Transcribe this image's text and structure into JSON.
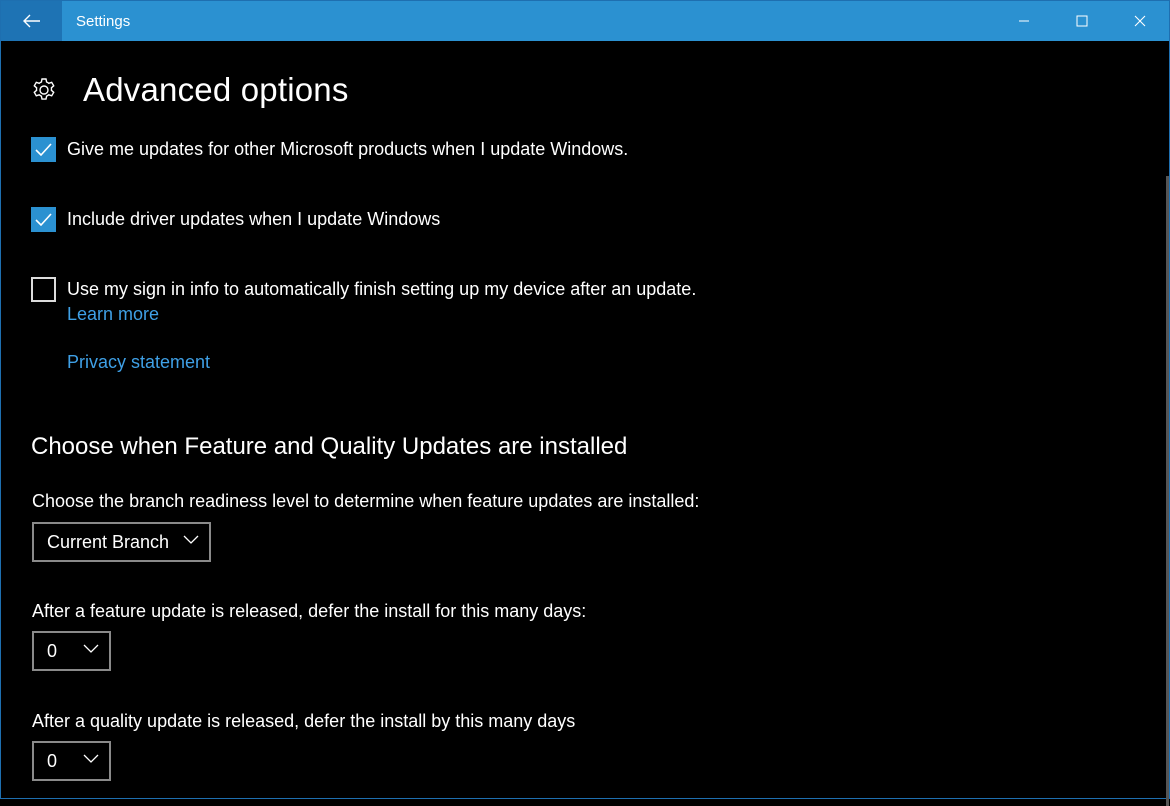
{
  "window": {
    "title": "Settings"
  },
  "page": {
    "title": "Advanced options"
  },
  "options": [
    {
      "label": "Give me updates for other Microsoft products when I update Windows.",
      "checked": true
    },
    {
      "label": "Include driver updates when I update Windows",
      "checked": true
    },
    {
      "label": "Use my sign in info to automatically finish setting up my device after an update.",
      "checked": false
    }
  ],
  "links": {
    "learn_more": "Learn more",
    "privacy": "Privacy statement"
  },
  "section": {
    "title": "Choose when Feature and Quality Updates are installed",
    "branch_label": "Choose the branch readiness level to determine when feature updates are installed:",
    "branch_value": "Current Branch",
    "feature_label": "After a feature update is released, defer the install for this many days:",
    "feature_value": "0",
    "quality_label": "After a quality update is released, defer the install by this many days",
    "quality_value": "0"
  },
  "colors": {
    "accent": "#2b91d1",
    "link": "#3fa0e6",
    "background": "#000000"
  }
}
